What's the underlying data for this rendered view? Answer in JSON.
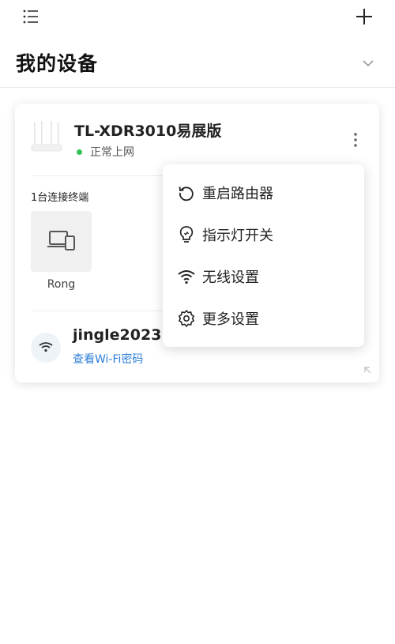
{
  "header": {
    "title": "我的设备"
  },
  "device": {
    "name": "TL-XDR3010易展版",
    "status": "正常上网",
    "status_color": "#35c05a",
    "clients_count_label": "1台连接终端",
    "clients": [
      {
        "name": "Rong",
        "icon": "laptop-phone-icon"
      }
    ],
    "wifi": {
      "ssid": "jingle2023",
      "password_link": "查看Wi-Fi密码",
      "link_color": "#2f80d6"
    }
  },
  "popup_menu": {
    "items": [
      {
        "label": "重启路由器",
        "icon": "restart-icon"
      },
      {
        "label": "指示灯开关",
        "icon": "lightbulb-icon"
      },
      {
        "label": "无线设置",
        "icon": "wifi-icon"
      },
      {
        "label": "更多设置",
        "icon": "gear-icon"
      }
    ]
  }
}
